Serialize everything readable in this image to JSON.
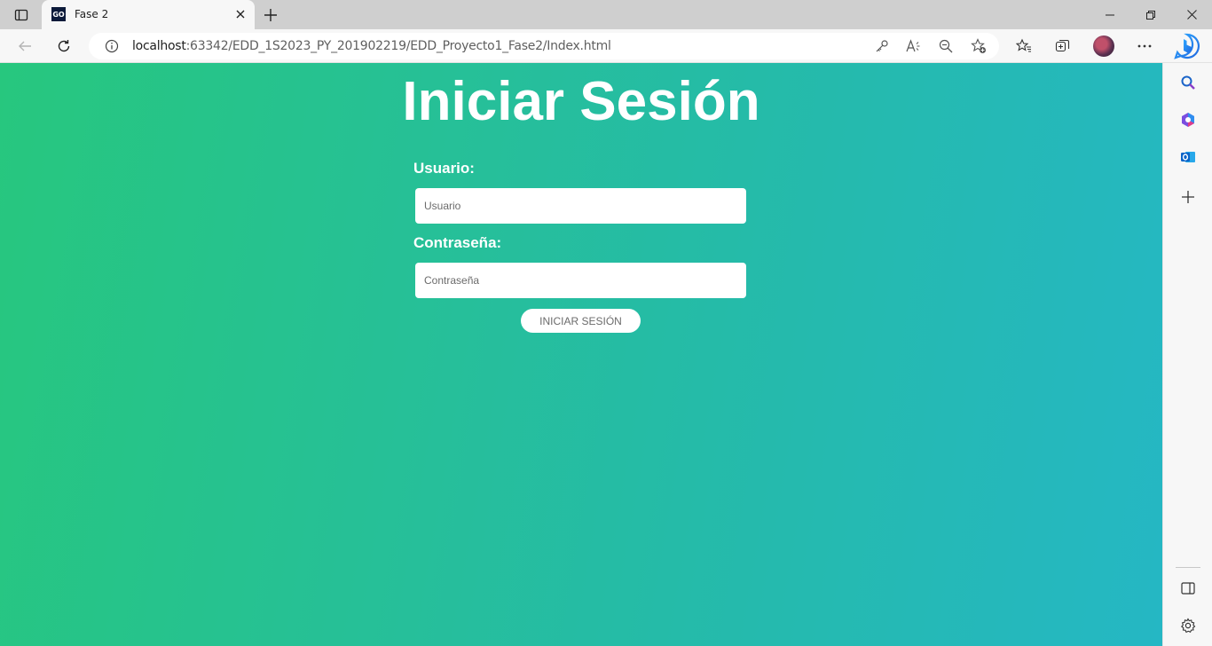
{
  "browser": {
    "tab": {
      "title": "Fase 2",
      "favicon_text": "GO"
    },
    "url": {
      "host": "localhost",
      "path": ":63342/EDD_1S2023_PY_201902219/EDD_Proyecto1_Fase2/Index.html"
    },
    "icons": {
      "tab_actions": "tab-actions-icon",
      "close_tab": "close-icon",
      "new_tab": "plus-icon",
      "minimize": "minimize-icon",
      "restore": "restore-icon",
      "close_window": "close-icon",
      "back": "back-arrow-icon",
      "refresh": "refresh-icon",
      "site_info": "info-icon",
      "key": "key-icon",
      "read_aloud": "read-aloud-icon",
      "zoom_out": "zoom-out-icon",
      "add_favorite": "star-plus-icon",
      "favorites": "favorites-icon",
      "collections": "collections-icon",
      "profile": "avatar",
      "more": "more-icon",
      "bing": "bing-icon"
    },
    "sidebar": {
      "items": [
        "search-icon",
        "office-icon",
        "outlook-icon",
        "plus-icon"
      ],
      "bottom": [
        "sidebar-toggle-icon",
        "gear-icon"
      ]
    }
  },
  "page": {
    "title": "Iniciar Sesión",
    "username_label": "Usuario:",
    "username_placeholder": "Usuario",
    "password_label": "Contraseña:",
    "password_placeholder": "Contraseña",
    "submit_label": "INICIAR SESIÓN",
    "gradient_start": "#27c77e",
    "gradient_end": "#25b7c4"
  }
}
